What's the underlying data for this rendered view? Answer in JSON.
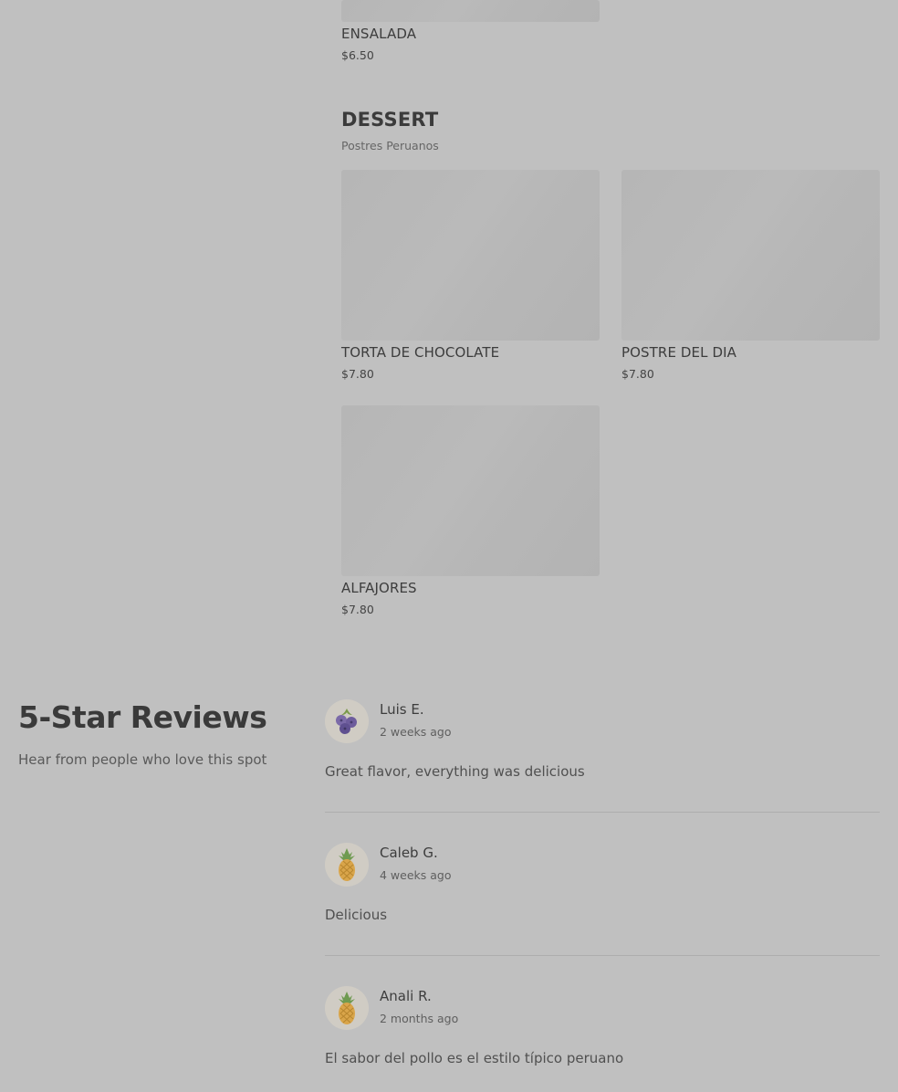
{
  "menu": {
    "prev_item": {
      "name": "ENSALADA",
      "price": "$6.50"
    },
    "category": {
      "title": "DESSERT",
      "subtitle": "Postres Peruanos",
      "items": [
        {
          "name": "TORTA DE CHOCOLATE",
          "price": "$7.80"
        },
        {
          "name": "POSTRE DEL DIA",
          "price": "$7.80"
        },
        {
          "name": "ALFAJORES",
          "price": "$7.80"
        }
      ]
    }
  },
  "reviews": {
    "heading": "5-Star Reviews",
    "subheading": "Hear from people who love this spot",
    "items": [
      {
        "name": "Luis E.",
        "time": "2 weeks ago",
        "text": "Great flavor, everything was delicious",
        "avatar_icon": "blueberry-icon"
      },
      {
        "name": "Caleb G.",
        "time": "4 weeks ago",
        "text": "Delicious",
        "avatar_icon": "pineapple-icon"
      },
      {
        "name": "Anali R.",
        "time": "2 months ago",
        "text": "El sabor del pollo es el estilo típico peruano",
        "avatar_icon": "pineapple-icon"
      }
    ]
  },
  "colors": {
    "overlay_background": "#c0c0c0",
    "image_placeholder": "#b6b6b6",
    "text_primary": "#3a3a3a",
    "avatar_background": "#d0ccc4"
  }
}
